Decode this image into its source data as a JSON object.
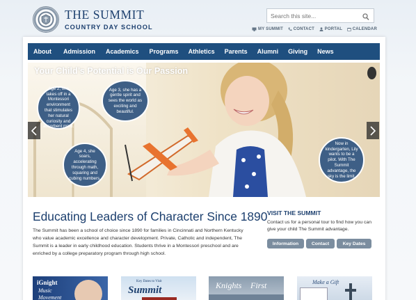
{
  "header": {
    "logo_line1": "THE SUMMIT",
    "logo_line2": "COUNTRY DAY SCHOOL",
    "logo_icon": "school-seal",
    "search_placeholder": "Search this site...",
    "links": [
      {
        "label": "MY SUMMIT",
        "icon": "monitor-icon"
      },
      {
        "label": "CONTACT",
        "icon": "phone-icon"
      },
      {
        "label": "PORTAL",
        "icon": "user-icon"
      },
      {
        "label": "CALENDAR",
        "icon": "calendar-icon"
      }
    ]
  },
  "nav": {
    "items": [
      "About",
      "Admission",
      "Academics",
      "Programs",
      "Athletics",
      "Parents",
      "Alumni",
      "Giving",
      "News"
    ]
  },
  "hero": {
    "title": "Your Child’s Potential is Our Passion",
    "bubbles": [
      "Age 2, she takes off in a Montessori environment that stimulates her natural curiosity and absorbent mind.",
      "Age 3, she has a gentle spirit and sees the world as exciting and beautiful.",
      "Age 4, she soars, accelerating through math, squaring and cubing numbers.",
      "Now in kindergarten, Lily wants to be a pilot. With The Summit advantage, the sky is the limit."
    ]
  },
  "main": {
    "headline": "Educating Leaders of Character Since 1890",
    "body": "The Summit has been a school of choice since 1890 for families in Cincinnati and Northern Kentucky who value academic excellence and character development. Private, Catholic and independent, The Summit is a leader in early childhood education. Students thrive in a Montessori preschool and are enriched by a college preparatory program through high school."
  },
  "visit": {
    "title": "VISIT THE SUMMIT",
    "text": "Contact us for a personal tour to find how you can give your child The Summit advantage.",
    "buttons": [
      "Information",
      "Contact",
      "Key Dates"
    ]
  },
  "thumbnails": [
    {
      "lines": [
        "iGnight",
        "Music",
        "Movement"
      ]
    },
    {
      "lines": [
        "Key Dates to Visit",
        "Summit"
      ]
    },
    {
      "lines": [
        "Knights",
        "First"
      ]
    },
    {
      "lines": [
        "Make a Gift"
      ]
    }
  ],
  "colors": {
    "brand_navy": "#1f4f7f",
    "bubble": "#3e5f86",
    "button": "#7b8d9f"
  }
}
